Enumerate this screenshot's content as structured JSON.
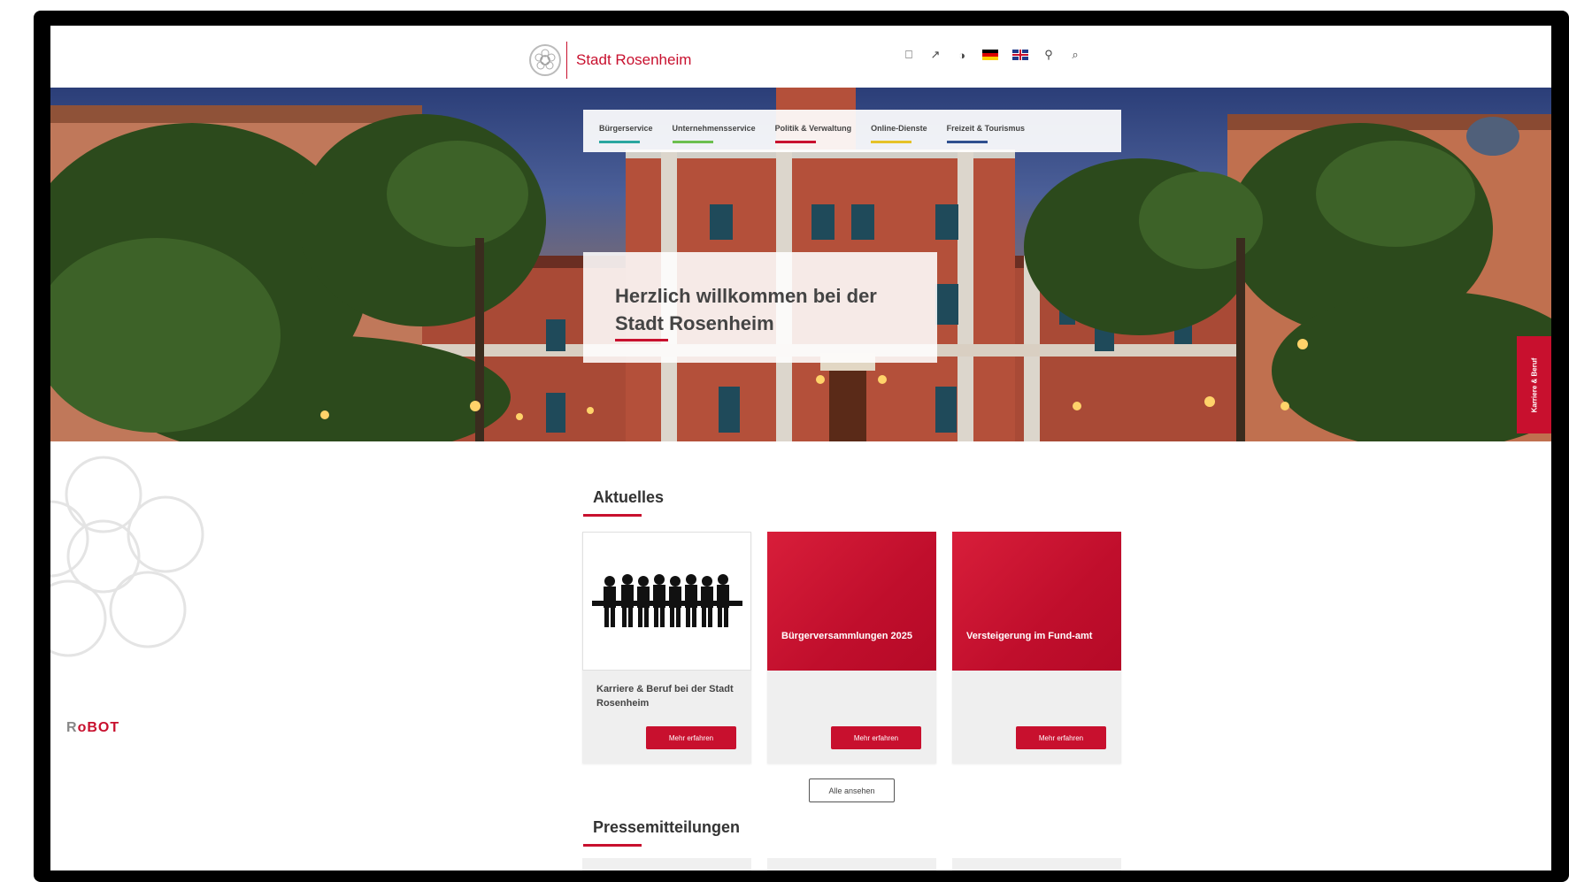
{
  "header": {
    "logo_text": "Stadt Rosenheim",
    "tools": [
      {
        "icon": "book-icon",
        "glyph": "⎕"
      },
      {
        "icon": "share-icon",
        "glyph": "↗"
      },
      {
        "icon": "contrast-icon",
        "glyph": "◑"
      },
      {
        "icon": "user-icon",
        "glyph": "⚲"
      },
      {
        "icon": "search-icon",
        "glyph": "⌕"
      }
    ]
  },
  "nav": {
    "items": [
      {
        "label": "Bürgerservice",
        "color": "#2aa6a0"
      },
      {
        "label": "Unternehmensservice",
        "color": "#6cbf4f"
      },
      {
        "label": "Politik & Verwaltung",
        "color": "#c8102e"
      },
      {
        "label": "Online-Dienste",
        "color": "#e6c229"
      },
      {
        "label": "Freizeit & Tourismus",
        "color": "#2f4f8f"
      }
    ]
  },
  "hero": {
    "welcome_line1": "Herzlich willkommen bei der",
    "welcome_line2": "Stadt Rosenheim",
    "side_tab": "Karriere & Beruf"
  },
  "robot_logo": {
    "part1": "R",
    "part2": "oBOT"
  },
  "aktuelles": {
    "title": "Aktuelles",
    "cards": [
      {
        "text": "Karriere & Beruf bei der Stadt Rosenheim",
        "button": "Mehr erfahren"
      },
      {
        "overlay": "Bürgerversammlungen 2025",
        "button": "Mehr erfahren"
      },
      {
        "overlay": "Versteigerung im Fund-amt",
        "button": "Mehr erfahren"
      }
    ],
    "all_button": "Alle ansehen"
  },
  "presse": {
    "title": "Pressemitteilungen"
  },
  "colors": {
    "brand": "#c8102e",
    "text": "#444444"
  }
}
